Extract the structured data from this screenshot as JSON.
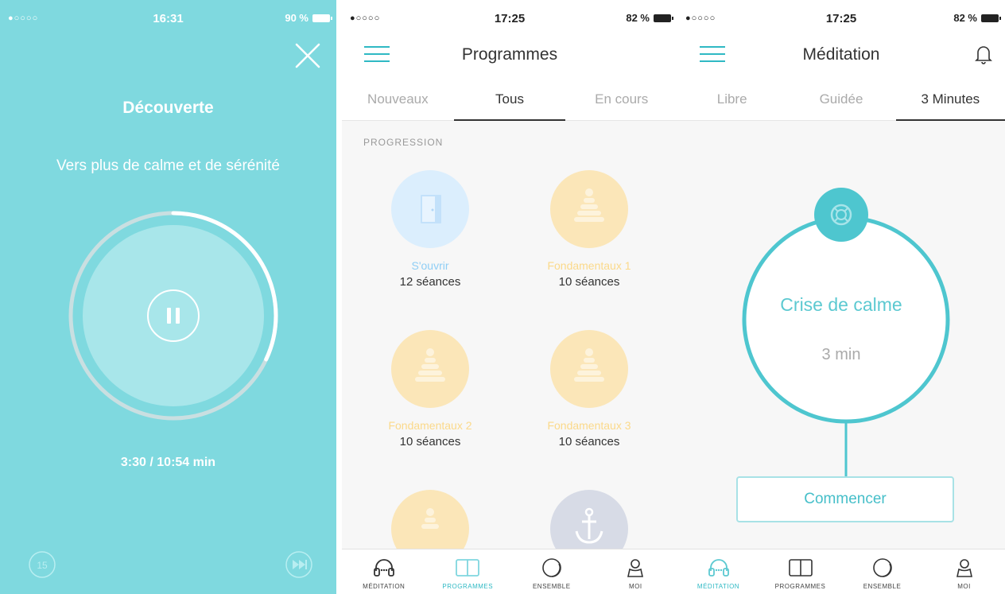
{
  "colors": {
    "accent": "#2fb9c4",
    "teal_bg": "#7fd9df",
    "yellow": "#fbe6b8",
    "blue_light": "#dbeefd"
  },
  "player": {
    "status": {
      "signal": "●○○○○",
      "time": "16:31",
      "battery": "90 %"
    },
    "title": "Découverte",
    "subtitle": "Vers plus de calme et de sérénité",
    "elapsed": "3:30 / 10:54 min",
    "progress_fraction": 0.32,
    "rewind_label": "15"
  },
  "programmes": {
    "status": {
      "signal": "●○○○○",
      "time": "17:25",
      "battery": "82 %"
    },
    "title": "Programmes",
    "tabs": [
      {
        "label": "Nouveaux"
      },
      {
        "label": "Tous"
      },
      {
        "label": "En cours"
      }
    ],
    "section": "PROGRESSION",
    "items": [
      {
        "name": "S'ouvrir",
        "count": "12 séances",
        "color": "#8fcef5",
        "icon": "door-icon"
      },
      {
        "name": "Fondamentaux 1",
        "count": "10 séances",
        "color": "#fbd98a",
        "icon": "stack-icon"
      },
      {
        "name": "Fondamentaux 2",
        "count": "10 séances",
        "color": "#fbd98a",
        "icon": "stack-icon"
      },
      {
        "name": "Fondamentaux 3",
        "count": "10 séances",
        "color": "#fbd98a",
        "icon": "stack-icon"
      }
    ]
  },
  "meditation": {
    "status": {
      "signal": "●○○○○",
      "time": "17:25",
      "battery": "82 %"
    },
    "title": "Méditation",
    "tabs": [
      {
        "label": "Libre"
      },
      {
        "label": "Guidée"
      },
      {
        "label": "3 Minutes"
      }
    ],
    "session_title": "Crise de calme",
    "session_duration": "3 min",
    "start_label": "Commencer"
  },
  "tabbar": [
    {
      "label": "MÉDITATION",
      "icon": "headphones-icon"
    },
    {
      "label": "PROGRAMMES",
      "icon": "book-icon"
    },
    {
      "label": "ENSEMBLE",
      "icon": "circle-icon"
    },
    {
      "label": "MOI",
      "icon": "person-icon"
    }
  ]
}
